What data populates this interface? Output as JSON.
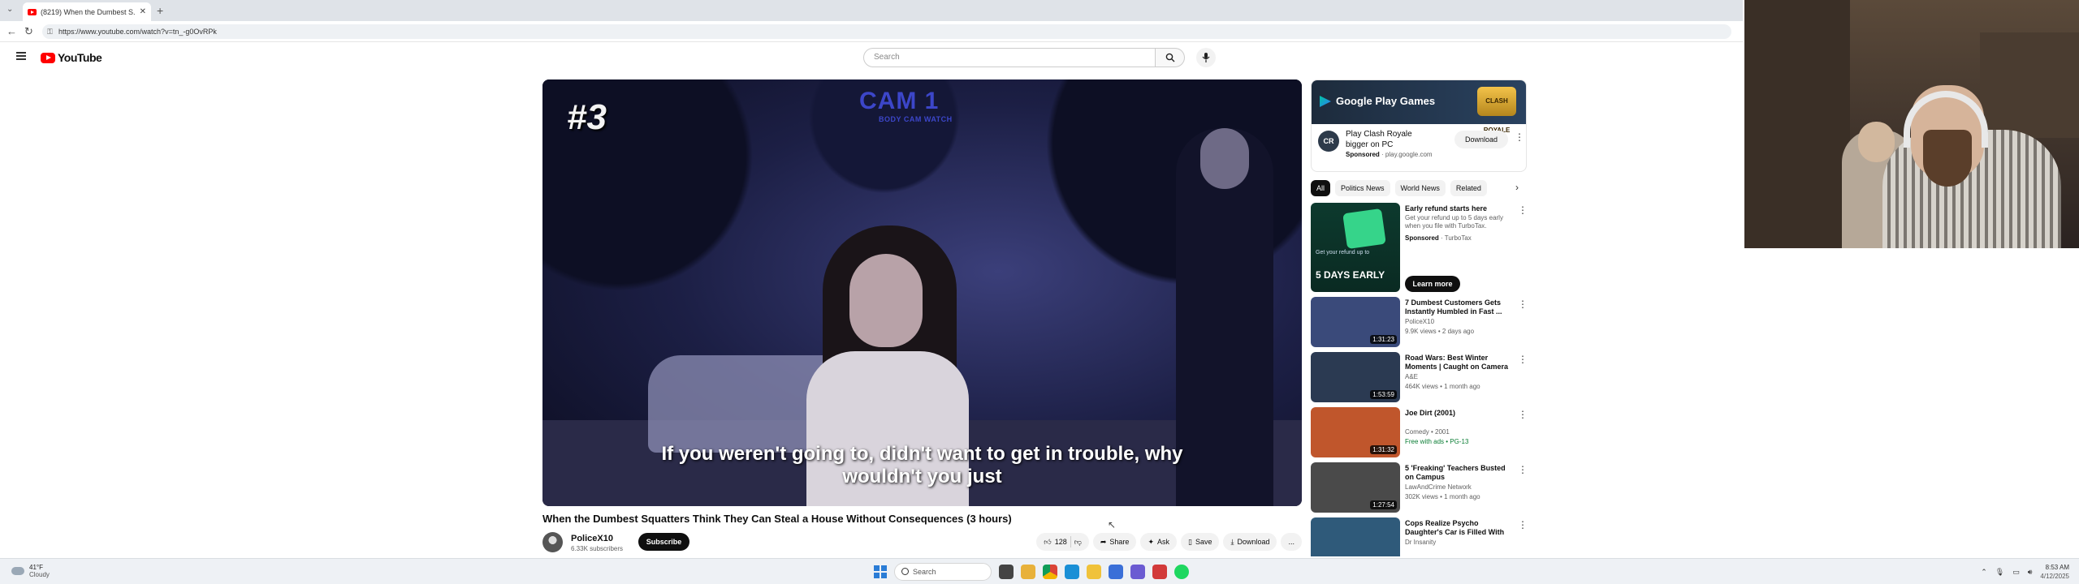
{
  "browser": {
    "tab_title": "(8219) When the Dumbest S...",
    "new_tab": "+",
    "url": "https://www.youtube.com/watch?v=tn_-g0OvRPk"
  },
  "header": {
    "logo_text": "YouTube",
    "search_placeholder": "Search"
  },
  "video": {
    "overlay_episode": "#3",
    "overlay_cam": "CAM 1",
    "overlay_cam_sub": "BODY CAM WATCH",
    "caption_line1": "If you weren't going to, didn't want to get in trouble, why",
    "caption_line2": "wouldn't you just",
    "title": "When the Dumbest Squatters Think They Can Steal a House Without Consequences (3 hours)",
    "channel_name": "PoliceX10",
    "channel_subs": "6.33K subscribers",
    "subscribe_label": "Subscribe",
    "like_count": "128",
    "share_label": "Share",
    "ask_label": "Ask",
    "save_label": "Save",
    "download_label": "Download",
    "more_label": "..."
  },
  "sidebar": {
    "ad": {
      "banner_text": "Google Play Games",
      "badge_text": "CLASH ROYALE",
      "logo_text": "CR",
      "title": "Play Clash Royale bigger on PC",
      "sponsored": "Sponsored",
      "domain": "play.google.com",
      "download_label": "Download"
    },
    "chips": [
      "All",
      "Politics News",
      "World News",
      "Related"
    ],
    "promo": {
      "title": "Early refund starts here",
      "description": "Get your refund up to 5 days early when you file with TurboTax.",
      "sponsored": "Sponsored",
      "advertiser": "TurboTax",
      "thumb_small": "Get your refund up to",
      "thumb_big": "5 DAYS EARLY",
      "learn_label": "Learn more"
    },
    "recommendations": [
      {
        "title": "7 Dumbest Customers Gets Instantly Humbled in Fast ...",
        "channel": "PoliceX10",
        "meta": "9.9K views • 2 days ago",
        "duration": "1:31:23",
        "thumb_color": "#3a4a7a"
      },
      {
        "title": "Road Wars: Best Winter Moments | Caught on Camera ...",
        "channel": "A&E",
        "meta": "464K views • 1 month ago",
        "duration": "1:53:59",
        "thumb_color": "#2b3a52"
      },
      {
        "title": "Joe Dirt (2001)",
        "channel": "Comedy • 2001",
        "meta": "Free with ads • PG-13",
        "duration": "1:31:32",
        "thumb_color": "#c0562c"
      },
      {
        "title": "5 'Freaking' Teachers Busted on Campus",
        "channel": "LawAndCrime Network",
        "meta": "302K views • 1 month ago",
        "duration": "1:27:54",
        "thumb_color": "#4a4a4a"
      },
      {
        "title": "Cops Realize Psycho Daughter's Car is Filled With Bodies",
        "channel": "Dr Insanity",
        "meta": "",
        "duration": "",
        "thumb_color": "#2f5a7a"
      }
    ]
  },
  "taskbar": {
    "temp": "41°F",
    "weather": "Cloudy",
    "search_label": "Search",
    "time": "8:53 AM",
    "date": "4/12/2025"
  }
}
